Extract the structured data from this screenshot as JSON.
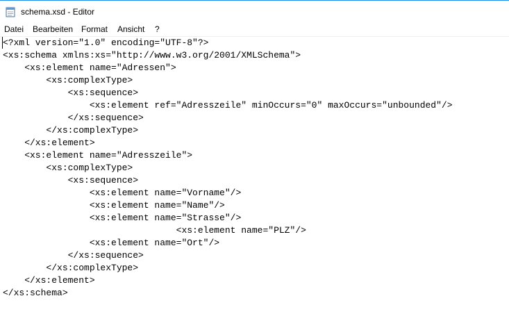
{
  "window": {
    "title": "schema.xsd - Editor",
    "app_icon": "notepad-icon"
  },
  "menu": {
    "items": [
      {
        "label": "Datei"
      },
      {
        "label": "Bearbeiten"
      },
      {
        "label": "Format"
      },
      {
        "label": "Ansicht"
      },
      {
        "label": "?"
      }
    ]
  },
  "editor": {
    "lines": [
      "<?xml version=\"1.0\" encoding=\"UTF-8\"?>",
      "<xs:schema xmlns:xs=\"http://www.w3.org/2001/XMLSchema\">",
      "    <xs:element name=\"Adressen\">",
      "        <xs:complexType>",
      "            <xs:sequence>",
      "                <xs:element ref=\"Adresszeile\" minOccurs=\"0\" maxOccurs=\"unbounded\"/>",
      "            </xs:sequence>",
      "        </xs:complexType>",
      "    </xs:element>",
      "    <xs:element name=\"Adresszeile\">",
      "        <xs:complexType>",
      "            <xs:sequence>",
      "                <xs:element name=\"Vorname\"/>",
      "                <xs:element name=\"Name\"/>",
      "                <xs:element name=\"Strasse\"/>",
      "                                <xs:element name=\"PLZ\"/>",
      "                <xs:element name=\"Ort\"/>",
      "            </xs:sequence>",
      "        </xs:complexType>",
      "    </xs:element>",
      "</xs:schema>"
    ]
  }
}
